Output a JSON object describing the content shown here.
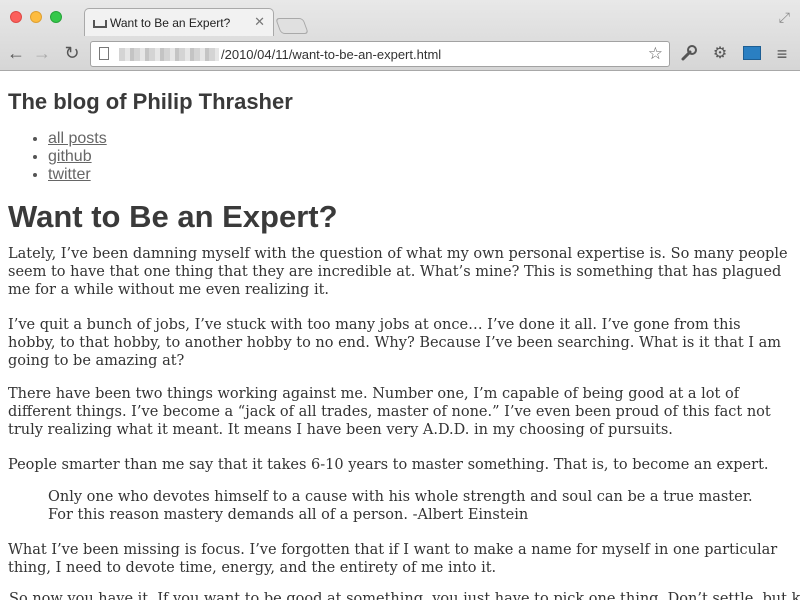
{
  "browser": {
    "tab_title": "Want to Be an Expert?",
    "tab_close": "✕",
    "url_path": "/2010/04/11/want-to-be-an-expert.html",
    "icons": {
      "back": "←",
      "forward": "→",
      "reload": "↻",
      "star": "☆",
      "wrench": "🔧",
      "gear": "⚙",
      "menu": "≡",
      "fullscreen": "⤢"
    }
  },
  "blog": {
    "title": "The blog of Philip Thrasher",
    "nav": [
      "all posts",
      "github",
      "twitter"
    ]
  },
  "post": {
    "title": "Want to Be an Expert?",
    "paragraphs": [
      "Lately, I’ve been damning myself with the question of what my own personal expertise is. So many people seem to have that one thing that they are incredible at. What’s mine? This is something that has plagued me for a while without me even realizing it.",
      "I’ve quit a bunch of jobs, I’ve stuck with too many jobs at once… I’ve done it all. I’ve gone from this hobby, to that hobby, to another hobby to no end. Why? Because I’ve been searching. What is it that I am going to be amazing at?",
      "There have been two things working against me. Number one, I’m capable of being good at a lot of different things. I’ve become a “jack of all trades, master of none.” I’ve even been proud of this fact not truly realizing what it meant. It means I have been very A.D.D. in my choosing of pursuits.",
      "People smarter than me say that it takes 6-10 years to master something. That is, to become an expert.",
      "What I’ve been missing is focus. I’ve forgotten that if I want to make a name for myself in one particular thing, I need to devote time, energy, and the entirety of me into it."
    ],
    "quote": "Only one who devotes himself to a cause with his whole strength and soul can be a true master. For this reason mastery demands all of a person. -Albert Einstein",
    "cutoff_line": "t. So now you have it. If you want to be good at something, you just have to pick one thing. Don’t settle, but keep"
  }
}
